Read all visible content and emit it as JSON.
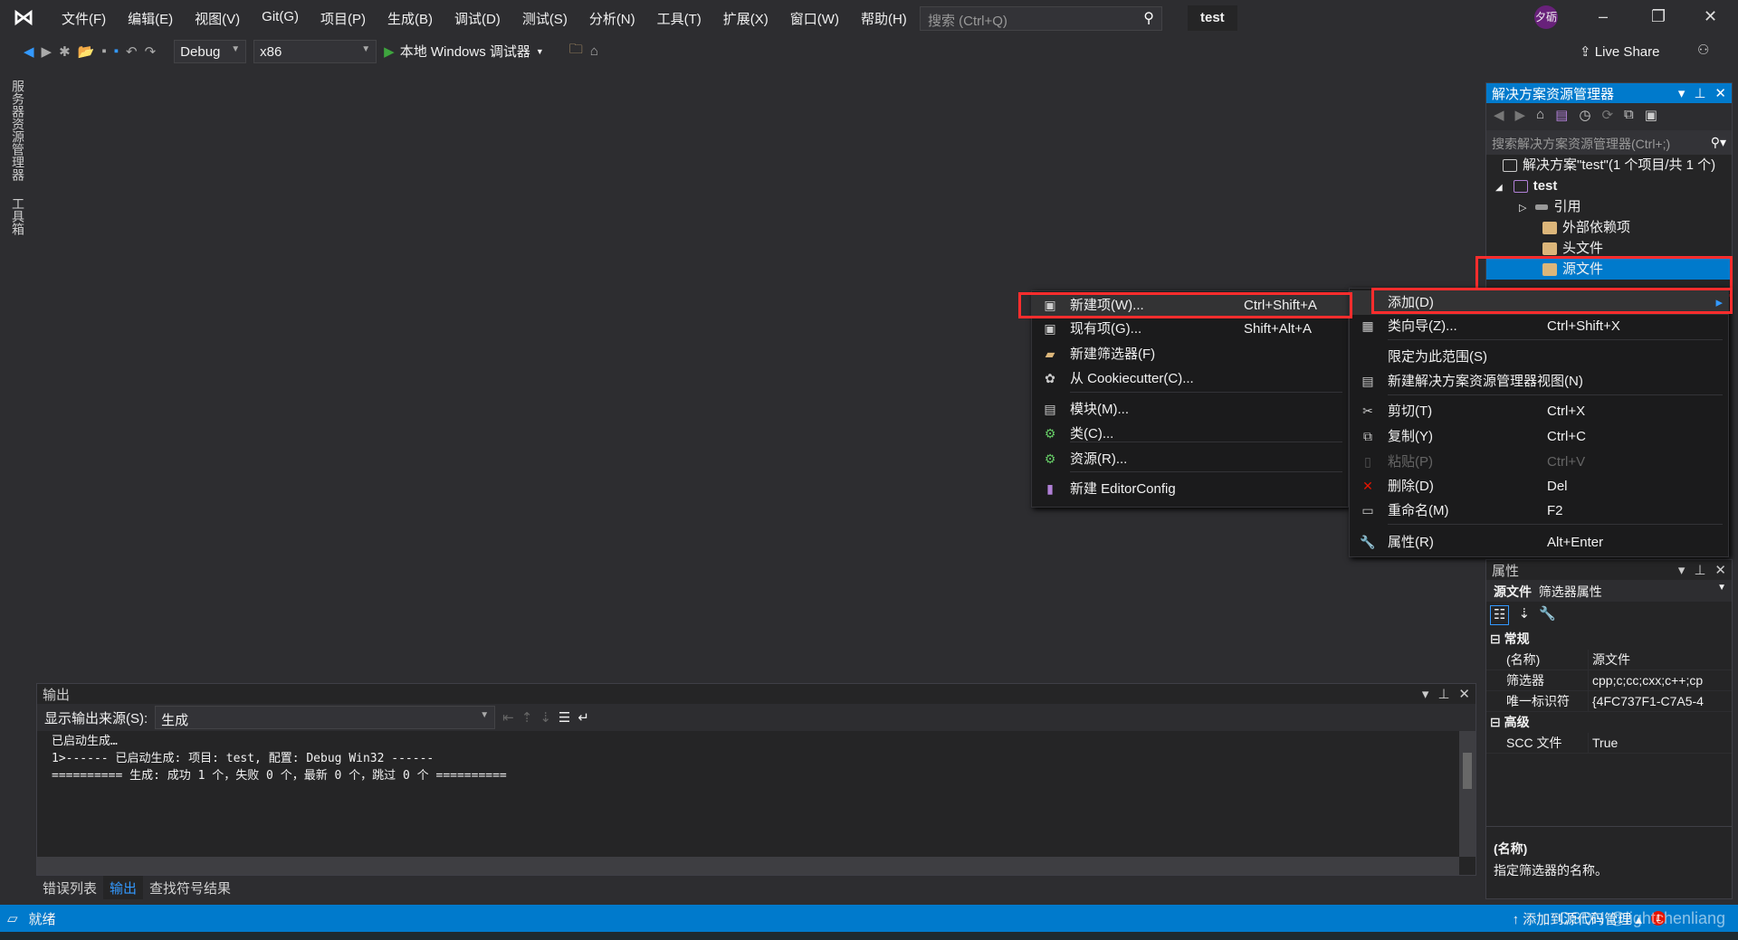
{
  "titlebar": {
    "menu": [
      "文件(F)",
      "编辑(E)",
      "视图(V)",
      "Git(G)",
      "项目(P)",
      "生成(B)",
      "调试(D)",
      "测试(S)",
      "分析(N)",
      "工具(T)",
      "扩展(X)",
      "窗口(W)",
      "帮助(H)"
    ],
    "search_placeholder": "搜索 (Ctrl+Q)",
    "project_name": "test",
    "avatar": "夕砺"
  },
  "toolbar": {
    "config": "Debug",
    "platform": "x86",
    "run_label": "本地 Windows 调试器",
    "live_share": "Live Share"
  },
  "left_tabs": [
    "服务器资源管理器",
    "工具箱"
  ],
  "solution_explorer": {
    "title": "解决方案资源管理器",
    "search_placeholder": "搜索解决方案资源管理器(Ctrl+;)",
    "tree": [
      {
        "label": "解决方案\"test\"(1 个项目/共 1 个)"
      },
      {
        "label": "test"
      },
      {
        "label": "引用"
      },
      {
        "label": "外部依赖项"
      },
      {
        "label": "头文件"
      },
      {
        "label": "源文件",
        "selected": true
      }
    ]
  },
  "submenu": {
    "items": [
      {
        "label": "新建项(W)...",
        "shortcut": "Ctrl+Shift+A",
        "highlighted": true
      },
      {
        "label": "现有项(G)...",
        "shortcut": "Shift+Alt+A"
      },
      {
        "label": "新建筛选器(F)",
        "shortcut": ""
      },
      {
        "label": "从 Cookiecutter(C)...",
        "shortcut": ""
      },
      {
        "label": "模块(M)...",
        "shortcut": ""
      },
      {
        "label": "类(C)...",
        "shortcut": ""
      },
      {
        "label": "资源(R)...",
        "shortcut": ""
      },
      {
        "label": "新建 EditorConfig",
        "shortcut": ""
      }
    ]
  },
  "context_menu": {
    "items": [
      {
        "label": "添加(D)",
        "shortcut": "",
        "highlighted": true
      },
      {
        "label": "类向导(Z)...",
        "shortcut": "Ctrl+Shift+X"
      },
      {
        "label": "限定为此范围(S)",
        "shortcut": ""
      },
      {
        "label": "新建解决方案资源管理器视图(N)",
        "shortcut": ""
      },
      {
        "label": "剪切(T)",
        "shortcut": "Ctrl+X"
      },
      {
        "label": "复制(Y)",
        "shortcut": "Ctrl+C"
      },
      {
        "label": "粘贴(P)",
        "shortcut": "Ctrl+V",
        "disabled": true
      },
      {
        "label": "删除(D)",
        "shortcut": "Del"
      },
      {
        "label": "重命名(M)",
        "shortcut": "F2"
      },
      {
        "label": "属性(R)",
        "shortcut": "Alt+Enter"
      }
    ]
  },
  "properties": {
    "title": "属性",
    "object": "源文件",
    "object_type": "筛选器属性",
    "cat1": "常规",
    "rows1": [
      {
        "k": "(名称)",
        "v": "源文件"
      },
      {
        "k": "筛选器",
        "v": "cpp;c;cc;cxx;c++;cp"
      },
      {
        "k": "唯一标识符",
        "v": "{4FC737F1-C7A5-4"
      }
    ],
    "cat2": "高级",
    "rows2": [
      {
        "k": "SCC 文件",
        "v": "True"
      }
    ],
    "desc_title": "(名称)",
    "desc": "指定筛选器的名称。"
  },
  "output": {
    "title": "输出",
    "source_label": "显示输出来源(S):",
    "source_value": "生成",
    "lines": [
      "已启动生成…",
      "1>------ 已启动生成: 项目: test, 配置: Debug Win32 ------",
      "========== 生成: 成功 1 个，失败 0 个，最新 0 个，跳过 0 个 =========="
    ]
  },
  "bottom_tabs": [
    {
      "label": "错误列表"
    },
    {
      "label": "输出",
      "active": true
    },
    {
      "label": "查找符号结果"
    }
  ],
  "status": {
    "text": "就绪",
    "source_control": "添加到源代码管理",
    "notifications": "1",
    "watermark": "CSDN @lightchenliang"
  },
  "colors": {
    "accent": "#007acc",
    "highlight_box": "#ff2d2d"
  }
}
